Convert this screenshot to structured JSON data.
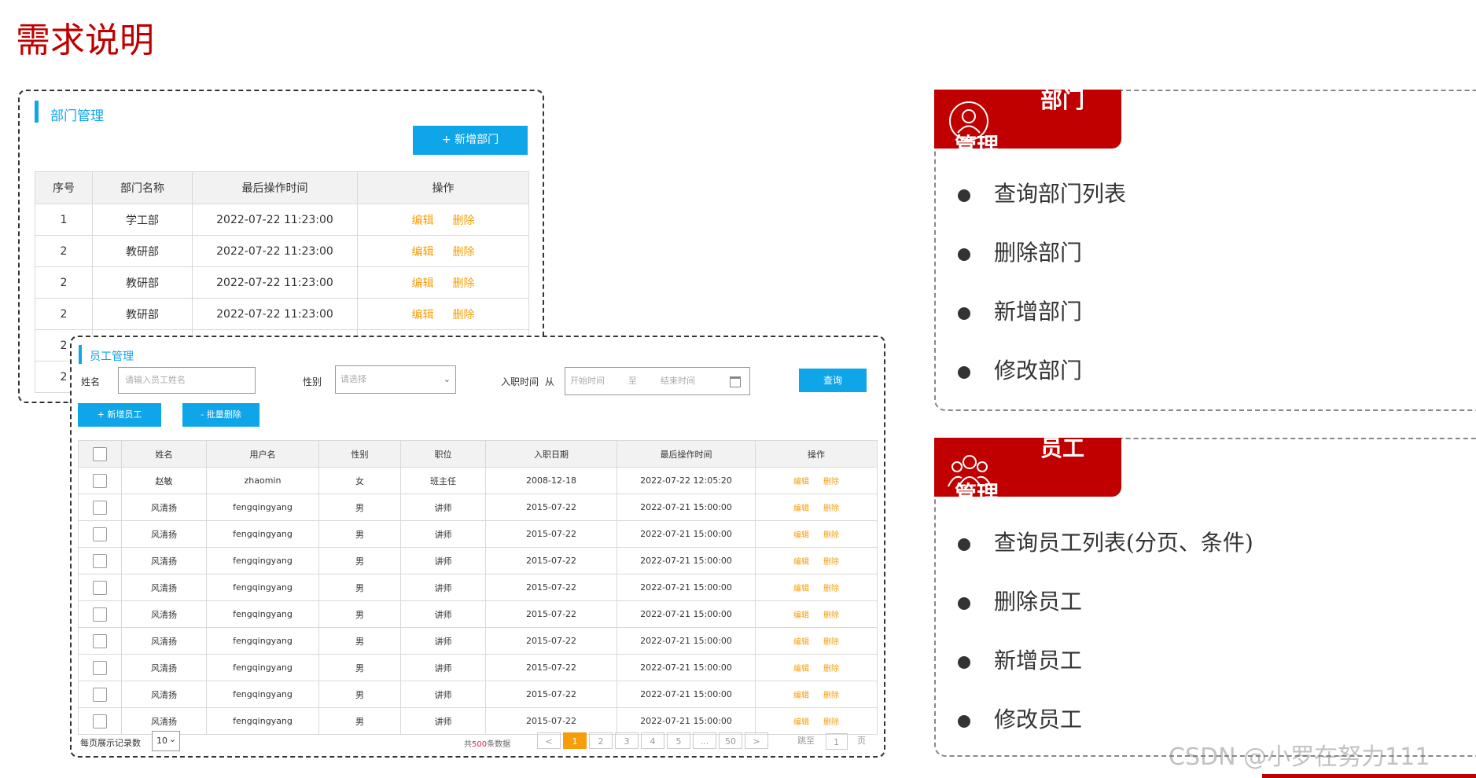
{
  "page_title": "需求说明",
  "dept": {
    "title": "部门管理",
    "add_button": "+ 新增部门",
    "headers": [
      "序号",
      "部门名称",
      "最后操作时间",
      "操作"
    ],
    "rows": [
      [
        "1",
        "学工部",
        "2022-07-22 11:23:00"
      ],
      [
        "2",
        "教研部",
        "2022-07-22 11:23:00"
      ],
      [
        "2",
        "教研部",
        "2022-07-22 11:23:00"
      ],
      [
        "2",
        "教研部",
        "2022-07-22 11:23:00"
      ],
      [
        "2",
        "",
        ""
      ],
      [
        "2",
        "",
        ""
      ]
    ],
    "edit": "编辑",
    "delete": "删除"
  },
  "emp": {
    "title": "员工管理",
    "name_label": "姓名",
    "name_placeholder": "请输入员工姓名",
    "gender_label": "性别",
    "gender_placeholder": "请选择",
    "date_label": "入职时间",
    "date_from": "从",
    "date_start_placeholder": "开始时间",
    "date_to": "至",
    "date_end_placeholder": "结束时间",
    "query_button": "查询",
    "add_button": "+ 新增员工",
    "batch_delete_button": "- 批量删除",
    "headers": [
      "姓名",
      "用户名",
      "性别",
      "职位",
      "入职日期",
      "最后操作时间",
      "操作"
    ],
    "rows": [
      [
        "赵敏",
        "zhaomin",
        "女",
        "班主任",
        "2008-12-18",
        "2022-07-22 12:05:20"
      ],
      [
        "风清扬",
        "fengqingyang",
        "男",
        "讲师",
        "2015-07-22",
        "2022-07-21 15:00:00"
      ],
      [
        "风清扬",
        "fengqingyang",
        "男",
        "讲师",
        "2015-07-22",
        "2022-07-21 15:00:00"
      ],
      [
        "风清扬",
        "fengqingyang",
        "男",
        "讲师",
        "2015-07-22",
        "2022-07-21 15:00:00"
      ],
      [
        "风清扬",
        "fengqingyang",
        "男",
        "讲师",
        "2015-07-22",
        "2022-07-21 15:00:00"
      ],
      [
        "风清扬",
        "fengqingyang",
        "男",
        "讲师",
        "2015-07-22",
        "2022-07-21 15:00:00"
      ],
      [
        "风清扬",
        "fengqingyang",
        "男",
        "讲师",
        "2015-07-22",
        "2022-07-21 15:00:00"
      ],
      [
        "风清扬",
        "fengqingyang",
        "男",
        "讲师",
        "2015-07-22",
        "2022-07-21 15:00:00"
      ],
      [
        "风清扬",
        "fengqingyang",
        "男",
        "讲师",
        "2015-07-22",
        "2022-07-21 15:00:00"
      ],
      [
        "风清扬",
        "fengqingyang",
        "男",
        "讲师",
        "2015-07-22",
        "2022-07-21 15:00:00"
      ]
    ],
    "edit": "编辑",
    "delete": "删除",
    "page_size_label": "每页展示记录数",
    "page_size": "10",
    "total_prefix": "共",
    "total": "500",
    "total_suffix": "条数据",
    "pager": {
      "prev": "<",
      "pages": [
        "1",
        "2",
        "3",
        "4",
        "5",
        "...",
        "50"
      ],
      "active": "1",
      "next": ">",
      "jump_label": "跳至",
      "jump_value": "1",
      "page_unit": "页"
    }
  },
  "panels": [
    {
      "title_line1": "部门",
      "title_line2": "管理",
      "icon": "person-icon",
      "items": [
        "查询部门列表",
        "删除部门",
        "新增部门",
        "修改部门"
      ]
    },
    {
      "title_line1": "员工",
      "title_line2": "管理",
      "icon": "group-icon",
      "items": [
        "查询员工列表(分页、条件)",
        "删除员工",
        "新增员工",
        "修改员工"
      ]
    }
  ],
  "watermark": "CSDN @小罗在努力111",
  "colors": {
    "brand_red": "#c00000",
    "accent_blue": "#0ea5e9",
    "action_orange": "#f59e0b"
  }
}
